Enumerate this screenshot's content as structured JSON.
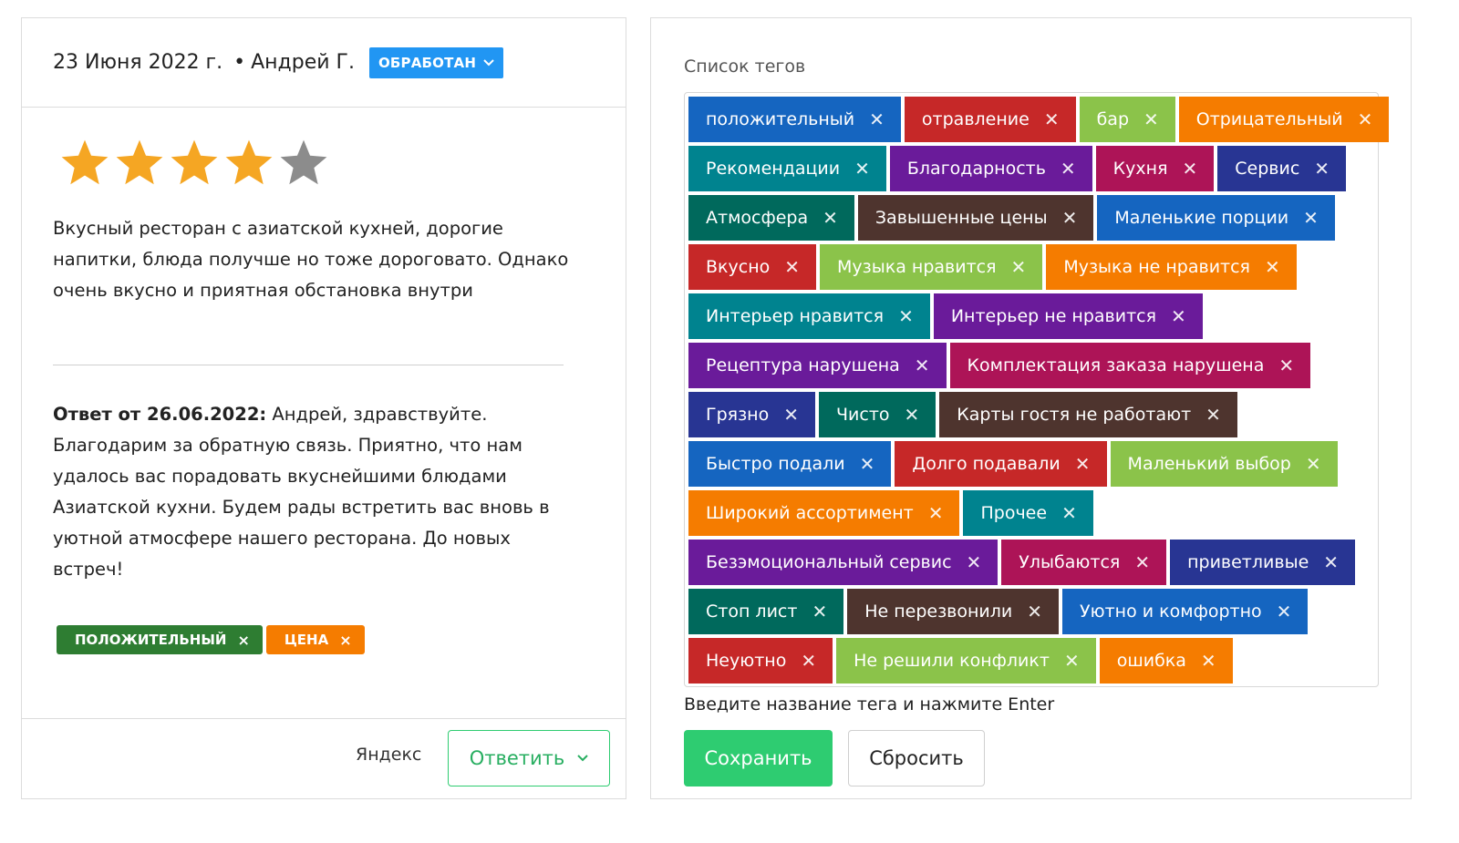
{
  "review": {
    "date": "23 Июня 2022 г.",
    "bullet": "•",
    "author": "Андрей Г.",
    "status": "ОБРАБОТАН",
    "rating": 4,
    "rating_max": 5,
    "text": "Вкусный ресторан с азиатской кухней, дорогие напитки, блюда получше но тоже дороговато. Однако очень вкусно и приятная обстановка внутри",
    "answer_label": "Ответ от 26.06.2022:",
    "answer_text": " Андрей, здравствуйте. Благодарим за обратную связь. Приятно, что нам удалось вас порадовать вкуснейшими блюдами Азиатской кухни. Будем рады встретить вас вновь в уютной атмосфере нашего ресторана. До новых встреч!",
    "tags": [
      {
        "label": "ПОЛОЖИТЕЛЬНЫЙ",
        "color": "#2e7d32"
      },
      {
        "label": "ЦЕНА",
        "color": "#f57c00"
      }
    ],
    "source": "Яндекс",
    "reply_label": "Ответить",
    "colors": {
      "star_on": "#f5a623",
      "star_off": "#8c8c8c",
      "badge": "#2196f3",
      "accent": "#2ecc71"
    }
  },
  "tag_panel": {
    "label": "Список тегов",
    "hint": "Введите название тега и нажмите Enter",
    "save_label": "Сохранить",
    "reset_label": "Сбросить",
    "remove_glyph": "✕",
    "rows": [
      [
        {
          "label": "положительный",
          "color": "#1565c0"
        },
        {
          "label": "отравление",
          "color": "#c62828"
        },
        {
          "label": "бар",
          "color": "#8bc34a"
        },
        {
          "label": "Отрицательный",
          "color": "#f57c00"
        }
      ],
      [
        {
          "label": "Рекомендации",
          "color": "#00838f"
        },
        {
          "label": "Благодарность",
          "color": "#6a1b9a"
        },
        {
          "label": "Кухня",
          "color": "#ad1457"
        },
        {
          "label": "Сервис",
          "color": "#283593"
        }
      ],
      [
        {
          "label": "Атмосфера",
          "color": "#00695c"
        },
        {
          "label": "Завышенные цены",
          "color": "#4e342e"
        },
        {
          "label": "Маленькие порции",
          "color": "#1565c0"
        }
      ],
      [
        {
          "label": "Вкусно",
          "color": "#c62828"
        },
        {
          "label": "Музыка нравится",
          "color": "#8bc34a"
        },
        {
          "label": "Музыка не нравится",
          "color": "#f57c00"
        }
      ],
      [
        {
          "label": "Интерьер нравится",
          "color": "#00838f"
        },
        {
          "label": "Интерьер не нравится",
          "color": "#6a1b9a"
        }
      ],
      [
        {
          "label": "Рецептура нарушена",
          "color": "#6a1b9a"
        },
        {
          "label": "Комплектация заказа нарушена",
          "color": "#ad1457"
        }
      ],
      [
        {
          "label": "Грязно",
          "color": "#283593"
        },
        {
          "label": "Чисто",
          "color": "#00695c"
        },
        {
          "label": "Карты гостя не работают",
          "color": "#4e342e"
        }
      ],
      [
        {
          "label": "Быстро подали",
          "color": "#1565c0"
        },
        {
          "label": "Долго подавали",
          "color": "#c62828"
        },
        {
          "label": "Маленький выбор",
          "color": "#8bc34a"
        }
      ],
      [
        {
          "label": "Широкий ассортимент",
          "color": "#f57c00"
        },
        {
          "label": "Прочее",
          "color": "#00838f"
        }
      ],
      [
        {
          "label": "Безэмоциональный сервис",
          "color": "#6a1b9a"
        },
        {
          "label": "Улыбаются",
          "color": "#ad1457"
        },
        {
          "label": "приветливые",
          "color": "#283593"
        }
      ],
      [
        {
          "label": "Стоп лист",
          "color": "#00695c"
        },
        {
          "label": "Не перезвонили",
          "color": "#4e342e"
        },
        {
          "label": "Уютно и комфортно",
          "color": "#1565c0"
        }
      ],
      [
        {
          "label": "Неуютно",
          "color": "#c62828"
        },
        {
          "label": "Не решили конфликт",
          "color": "#8bc34a"
        },
        {
          "label": "ошибка",
          "color": "#f57c00"
        }
      ]
    ]
  }
}
